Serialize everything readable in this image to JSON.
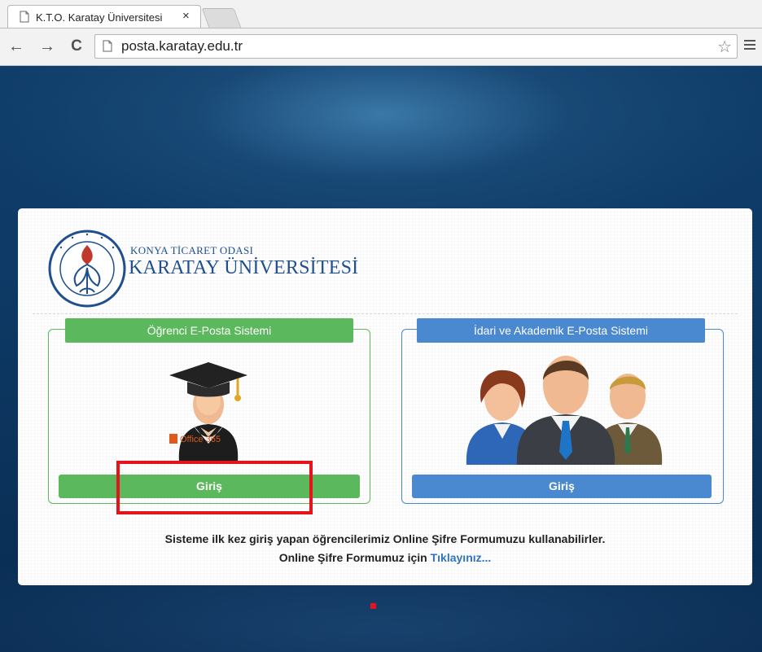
{
  "browser": {
    "tab_title": "K.T.O. Karatay Üniversitesi",
    "tab_close": "×",
    "url": "posta.karatay.edu.tr",
    "back": "←",
    "forward": "→",
    "reload": "C",
    "star": "☆"
  },
  "logo": {
    "line1": "KONYA TİCARET ODASI",
    "line2": "KARATAY ÜNİVERSİTESİ",
    "seal_text": "KTO KARATAY ÜNİVERSİTESİ"
  },
  "panels": {
    "student": {
      "title": "Öğrenci E-Posta Sistemi",
      "button": "Giriş",
      "badge": "Office 365"
    },
    "staff": {
      "title": "İdari ve Akademik E-Posta Sistemi",
      "button": "Giriş"
    }
  },
  "info": {
    "line1": "Sisteme ilk kez giriş yapan öğrencilerimiz Online Şifre Formumuzu kullanabilirler.",
    "line2_prefix": "Online Şifre Formumuz için ",
    "line2_link": "Tıklayınız..."
  },
  "colors": {
    "student_green": "#5cb85c",
    "staff_blue": "#4a88d0",
    "highlight_red": "#e5141a",
    "brand_navy": "#1f4f8f"
  }
}
